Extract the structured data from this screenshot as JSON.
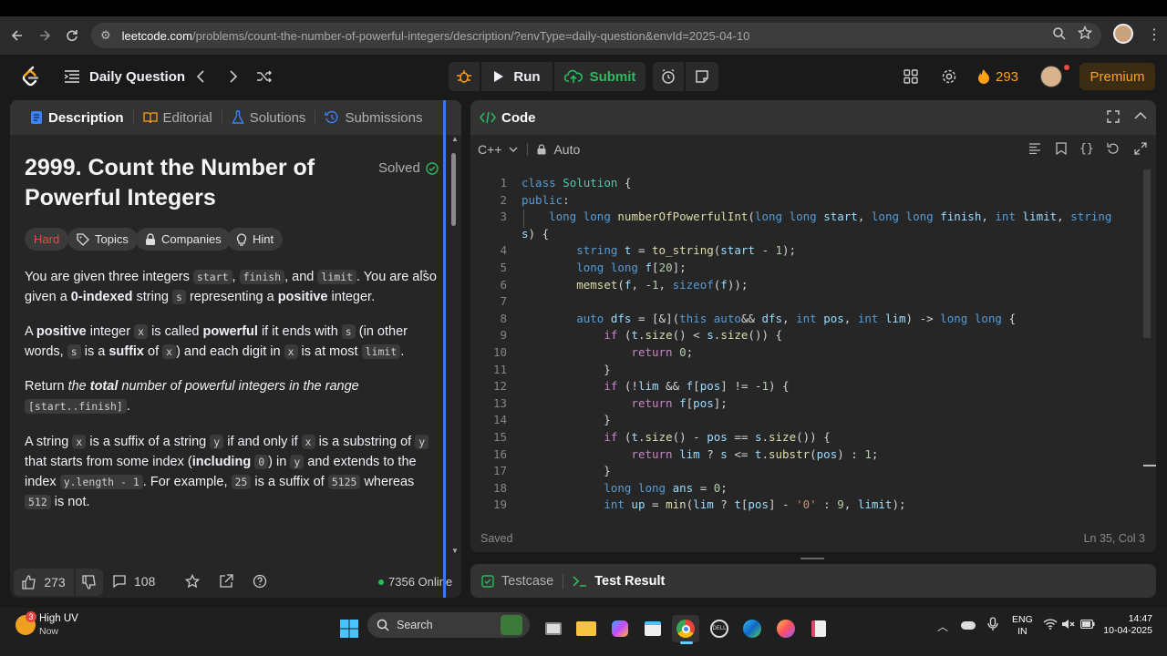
{
  "browser": {
    "url_host": "leetcode.com",
    "url_path": "/problems/count-the-number-of-powerful-integers/description/?envType=daily-question&envId=2025-04-10"
  },
  "nav": {
    "daily_label": "Daily Question",
    "run_label": "Run",
    "submit_label": "Submit",
    "streak_count": "293",
    "premium_label": "Premium"
  },
  "left": {
    "tabs": [
      "Description",
      "Editorial",
      "Solutions",
      "Submissions"
    ],
    "title": "2999. Count the Number of Powerful Integers",
    "solved_label": "Solved",
    "chips": [
      "Hard",
      "Topics",
      "Companies",
      "Hint"
    ],
    "likes": "273",
    "comments": "108",
    "online": "7356 Online"
  },
  "code": {
    "header": "Code",
    "language": "C++",
    "mode": "Auto",
    "status": "Saved",
    "position": "Ln 35, Col 3",
    "lines": [
      {
        "n": "1",
        "t": "class Solution {"
      },
      {
        "n": "2",
        "t": "public:"
      },
      {
        "n": "3",
        "t": "    long long numberOfPowerfulInt(long long start, long long finish, int limit, string"
      },
      {
        "n": "",
        "t": "s) {"
      },
      {
        "n": "4",
        "t": "        string t = to_string(start - 1);"
      },
      {
        "n": "5",
        "t": "        long long f[20];"
      },
      {
        "n": "6",
        "t": "        memset(f, -1, sizeof(f));"
      },
      {
        "n": "7",
        "t": ""
      },
      {
        "n": "8",
        "t": "        auto dfs = [&](this auto&& dfs, int pos, int lim) -> long long {"
      },
      {
        "n": "9",
        "t": "            if (t.size() < s.size()) {"
      },
      {
        "n": "10",
        "t": "                return 0;"
      },
      {
        "n": "11",
        "t": "            }"
      },
      {
        "n": "12",
        "t": "            if (!lim && f[pos] != -1) {"
      },
      {
        "n": "13",
        "t": "                return f[pos];"
      },
      {
        "n": "14",
        "t": "            }"
      },
      {
        "n": "15",
        "t": "            if (t.size() - pos == s.size()) {"
      },
      {
        "n": "16",
        "t": "                return lim ? s <= t.substr(pos) : 1;"
      },
      {
        "n": "17",
        "t": "            }"
      },
      {
        "n": "18",
        "t": "            long long ans = 0;"
      },
      {
        "n": "19",
        "t": "            int up = min(lim ? t[pos] - '0' : 9, limit);"
      }
    ]
  },
  "bottom": {
    "testcase": "Testcase",
    "test_result": "Test Result"
  },
  "taskbar": {
    "weather_title": "High UV",
    "weather_sub": "Now",
    "search": "Search",
    "lang_line1": "ENG",
    "lang_line2": "IN",
    "time": "14:47",
    "date": "10-04-2025",
    "badge": "3"
  },
  "colors": {
    "accent_orange": "#ffa116",
    "submit_green": "#2cbb5d",
    "hard_red": "#ef4743",
    "divider_blue": "#2f7cf6"
  }
}
